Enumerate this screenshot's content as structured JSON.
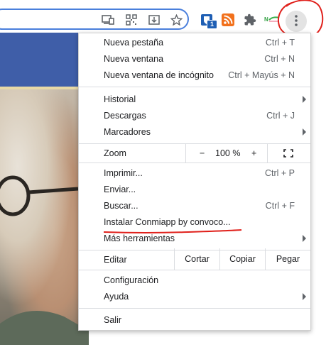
{
  "toolbar": {
    "icons": [
      "install-app-icon",
      "qr-code-icon",
      "download-page-icon",
      "bookmark-star-icon"
    ],
    "extensions": [
      {
        "name": "bitwarden-extension-icon",
        "badge": "1"
      },
      {
        "name": "rss-extension-icon"
      },
      {
        "name": "extensions-puzzle-icon"
      },
      {
        "name": "green-extension-icon"
      }
    ],
    "menu_icon": "kebab-menu-icon"
  },
  "menu": {
    "group1": [
      {
        "label": "Nueva pestaña",
        "shortcut": "Ctrl + T"
      },
      {
        "label": "Nueva ventana",
        "shortcut": "Ctrl + N"
      },
      {
        "label": "Nueva ventana de incógnito",
        "shortcut": "Ctrl + Mayús + N"
      }
    ],
    "group2": [
      {
        "label": "Historial",
        "submenu": true
      },
      {
        "label": "Descargas",
        "shortcut": "Ctrl + J"
      },
      {
        "label": "Marcadores",
        "submenu": true
      }
    ],
    "zoom": {
      "label": "Zoom",
      "minus": "−",
      "value": "100 %",
      "plus": "+"
    },
    "group3": [
      {
        "label": "Imprimir...",
        "shortcut": "Ctrl + P"
      },
      {
        "label": "Enviar..."
      },
      {
        "label": "Buscar...",
        "shortcut": "Ctrl + F"
      },
      {
        "label": "Instalar Conmiapp by convoco..."
      },
      {
        "label": "Más herramientas",
        "submenu": true
      }
    ],
    "edit": {
      "label": "Editar",
      "cut": "Cortar",
      "copy": "Copiar",
      "paste": "Pegar"
    },
    "group4": [
      {
        "label": "Configuración"
      },
      {
        "label": "Ayuda",
        "submenu": true
      }
    ],
    "exit": {
      "label": "Salir"
    }
  },
  "colors": {
    "accent": "#4a7fdc",
    "annotation": "#e0201b",
    "banner": "#3f5ea8"
  }
}
